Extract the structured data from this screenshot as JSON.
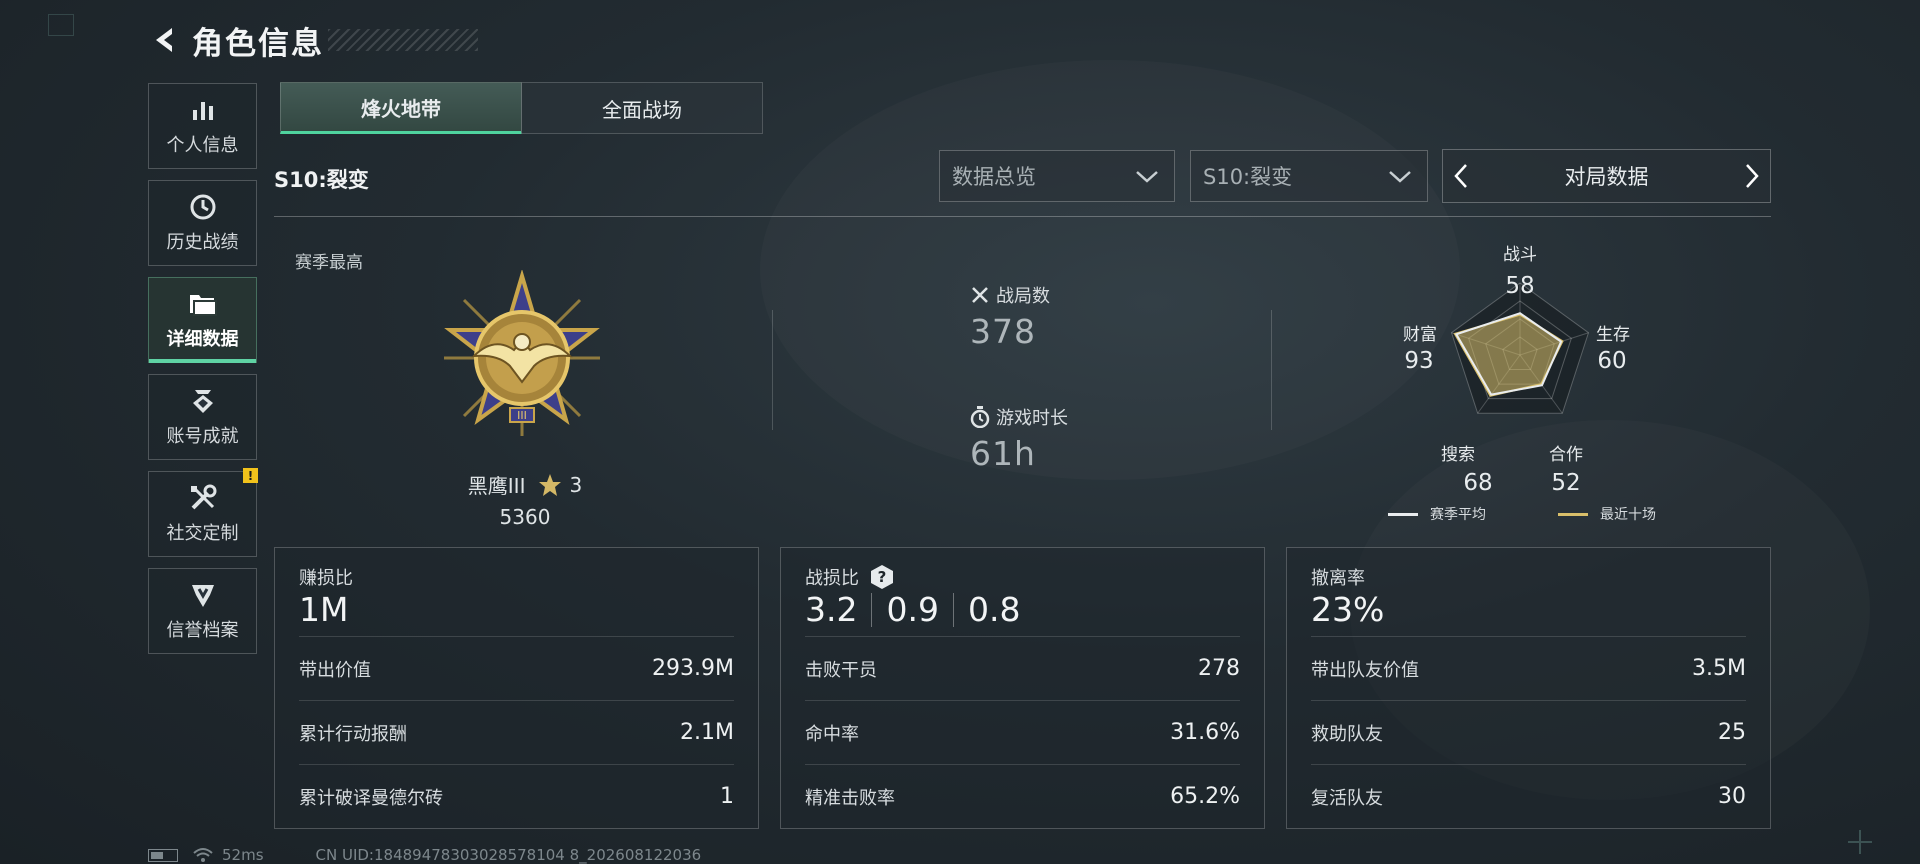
{
  "header": {
    "title": "角色信息"
  },
  "sidebar": {
    "items": [
      {
        "label": "个人信息",
        "icon": "bar-chart-icon"
      },
      {
        "label": "历史战绩",
        "icon": "clock-icon"
      },
      {
        "label": "详细数据",
        "icon": "folder-icon",
        "active": true
      },
      {
        "label": "账号成就",
        "icon": "achievement-icon"
      },
      {
        "label": "社交定制",
        "icon": "tools-icon",
        "badge": "!"
      },
      {
        "label": "信誉档案",
        "icon": "reputation-icon"
      }
    ]
  },
  "tabs": {
    "items": [
      "烽火地带",
      "全面战场"
    ],
    "active": "烽火地带"
  },
  "season": {
    "title": "S10:裂变"
  },
  "filters": {
    "view": "数据总览",
    "season": "S10:裂变",
    "pager_label": "对局数据"
  },
  "overview": {
    "season_best_label": "赛季最高",
    "rank": {
      "name": "黑鹰III",
      "stars": "3",
      "points": "5360"
    },
    "matches": {
      "label": "战局数",
      "value": "378"
    },
    "playtime": {
      "label": "游戏时长",
      "value": "61h"
    }
  },
  "radar": {
    "axes": [
      {
        "label": "战斗",
        "value": "58"
      },
      {
        "label": "生存",
        "value": "60"
      },
      {
        "label": "合作",
        "value": "52"
      },
      {
        "label": "搜索",
        "value": "68"
      },
      {
        "label": "财富",
        "value": "93"
      }
    ],
    "legend": [
      {
        "label": "赛季平均",
        "color": "#e9ecee"
      },
      {
        "label": "最近十场",
        "color": "#d9bf6a"
      }
    ],
    "season_avg": [
      58,
      60,
      52,
      68,
      93
    ],
    "recent_ten": [
      56,
      62,
      50,
      70,
      95
    ],
    "max": 100
  },
  "cards": [
    {
      "title": "赚损比",
      "main": "1M",
      "rows": [
        {
          "label": "带出价值",
          "value": "293.9M"
        },
        {
          "label": "累计行动报酬",
          "value": "2.1M"
        },
        {
          "label": "累计破译曼德尔砖",
          "value": "1"
        }
      ]
    },
    {
      "title": "战损比",
      "help": "?",
      "main_parts": [
        "3.2",
        "0.9",
        "0.8"
      ],
      "rows": [
        {
          "label": "击败干员",
          "value": "278"
        },
        {
          "label": "命中率",
          "value": "31.6%"
        },
        {
          "label": "精准击败率",
          "value": "65.2%"
        }
      ]
    },
    {
      "title": "撤离率",
      "main": "23%",
      "rows": [
        {
          "label": "带出队友价值",
          "value": "3.5M"
        },
        {
          "label": "救助队友",
          "value": "25"
        },
        {
          "label": "复活队友",
          "value": "30"
        }
      ]
    }
  ],
  "status": {
    "ping": "52ms",
    "uid": "CN UID:18489478303028578104 8_202608122036"
  },
  "colors": {
    "accent": "#4fd39e",
    "gold": "#d9bf6a",
    "badge": "#f1c21b"
  }
}
